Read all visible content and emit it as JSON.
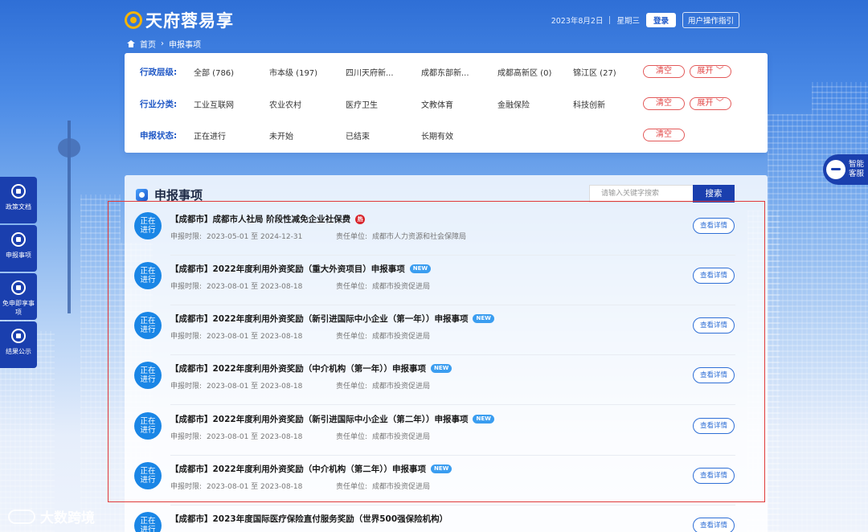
{
  "header": {
    "logo": "天府蓉易享",
    "date": "2023年8月2日",
    "weekday": "星期三",
    "login": "登录",
    "guide": "用户操作指引"
  },
  "breadcrumb": {
    "home": "首页",
    "current": "申报事项"
  },
  "filters": {
    "admin_label": "行政层级:",
    "admin_options": [
      "全部 (786)",
      "市本级 (197)",
      "四川天府新...",
      "成都东部新...",
      "成都高新区 (0)",
      "锦江区 (27)"
    ],
    "industry_label": "行业分类:",
    "industry_options": [
      "工业互联网",
      "农业农村",
      "医疗卫生",
      "文教体育",
      "金融保险",
      "科技创新"
    ],
    "status_label": "申报状态:",
    "status_options": [
      "正在进行",
      "未开始",
      "已结束",
      "长期有效"
    ],
    "clear": "清空",
    "expand": "展开"
  },
  "main": {
    "title": "申报事项",
    "search_placeholder": "请输入关键字搜索",
    "search_button": "搜索",
    "period_label": "申报时限:",
    "dept_label": "责任单位:",
    "detail_button": "查看详情",
    "status_line1": "正在",
    "status_line2": "进行",
    "new_tag": "NEW",
    "hot_tag": "热",
    "items": [
      {
        "title": "【成都市】成都市人社局 阶段性减免企业社保费",
        "tag": "hot",
        "period": "2023-05-01 至 2024-12-31",
        "dept": "成都市人力资源和社会保障局"
      },
      {
        "title": "【成都市】2022年度利用外资奖励（重大外资项目）申报事项",
        "tag": "new",
        "period": "2023-08-01 至 2023-08-18",
        "dept": "成都市投资促进局"
      },
      {
        "title": "【成都市】2022年度利用外资奖励（新引进国际中小企业（第一年））申报事项",
        "tag": "new",
        "period": "2023-08-01 至 2023-08-18",
        "dept": "成都市投资促进局"
      },
      {
        "title": "【成都市】2022年度利用外资奖励（中介机构（第一年））申报事项",
        "tag": "new",
        "period": "2023-08-01 至 2023-08-18",
        "dept": "成都市投资促进局"
      },
      {
        "title": "【成都市】2022年度利用外资奖励（新引进国际中小企业（第二年））申报事项",
        "tag": "new",
        "period": "2023-08-01 至 2023-08-18",
        "dept": "成都市投资促进局"
      },
      {
        "title": "【成都市】2022年度利用外资奖励（中介机构（第二年））申报事项",
        "tag": "new",
        "period": "2023-08-01 至 2023-08-18",
        "dept": "成都市投资促进局"
      },
      {
        "title": "【成都市】2023年度国际医疗保险直付服务奖励（世界500强保险机构）",
        "tag": "",
        "period": "",
        "dept": ""
      }
    ]
  },
  "side_nav": [
    "政策文档",
    "申报事项",
    "免申即享事项",
    "结果公示"
  ],
  "service": {
    "line1": "智能",
    "line2": "客服"
  },
  "watermark": "大数跨境"
}
